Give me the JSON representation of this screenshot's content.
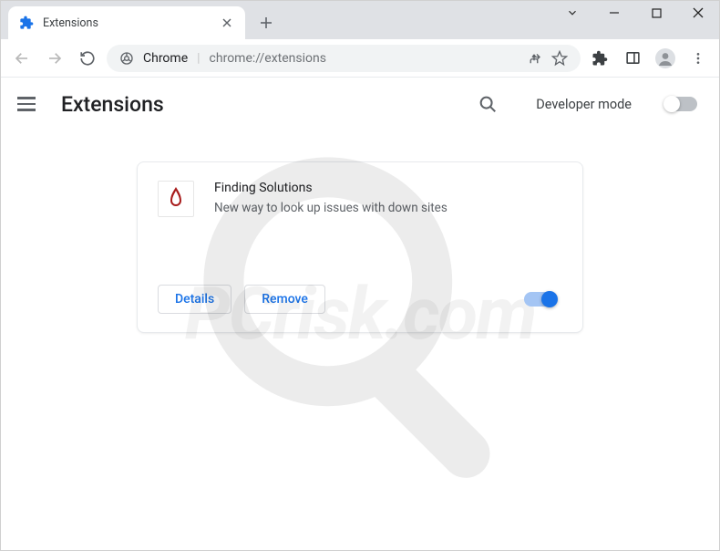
{
  "window": {
    "tab_title": "Extensions",
    "chrome_label": "Chrome",
    "url_path": "chrome://extensions"
  },
  "page": {
    "title": "Extensions",
    "dev_mode_label": "Developer mode"
  },
  "extension": {
    "name": "Finding Solutions",
    "description": "New way to look up issues with down sites",
    "details_label": "Details",
    "remove_label": "Remove",
    "enabled": true
  },
  "watermark": "PCrisk.com"
}
